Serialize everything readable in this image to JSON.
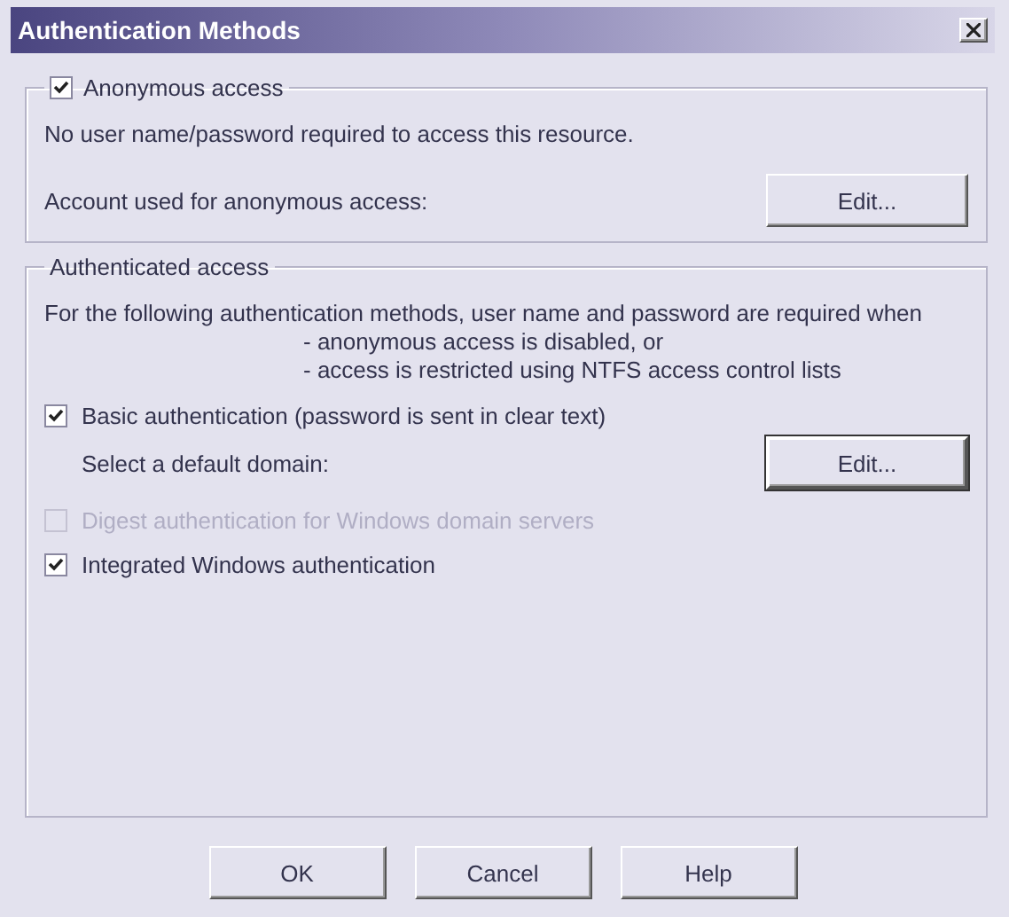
{
  "window": {
    "title": "Authentication Methods"
  },
  "anonymous": {
    "label": "Anonymous access",
    "checked": true,
    "description": "No user name/password required to access this resource.",
    "account_label": "Account used for anonymous access:",
    "button": {
      "label": "Edit...",
      "focused": false
    }
  },
  "authenticated": {
    "title": "Authenticated access",
    "intro": "For the following authentication methods, user name and password are required when",
    "conditions": [
      "- anonymous access is disabled, or",
      "- access is restricted using NTFS access control lists"
    ],
    "options": [
      {
        "kind": "checkbox",
        "label": "Basic authentication (password is sent in clear text)",
        "checked": true,
        "disabled": false
      },
      {
        "kind": "setting",
        "label": "Select a default domain:",
        "button": {
          "label": "Edit...",
          "focused": true
        }
      },
      {
        "kind": "checkbox",
        "label": "Digest authentication for Windows domain servers",
        "checked": false,
        "disabled": true
      },
      {
        "kind": "checkbox",
        "label": "Integrated Windows authentication",
        "checked": true,
        "disabled": false
      }
    ]
  },
  "buttons": [
    "OK",
    "Cancel",
    "Help"
  ]
}
